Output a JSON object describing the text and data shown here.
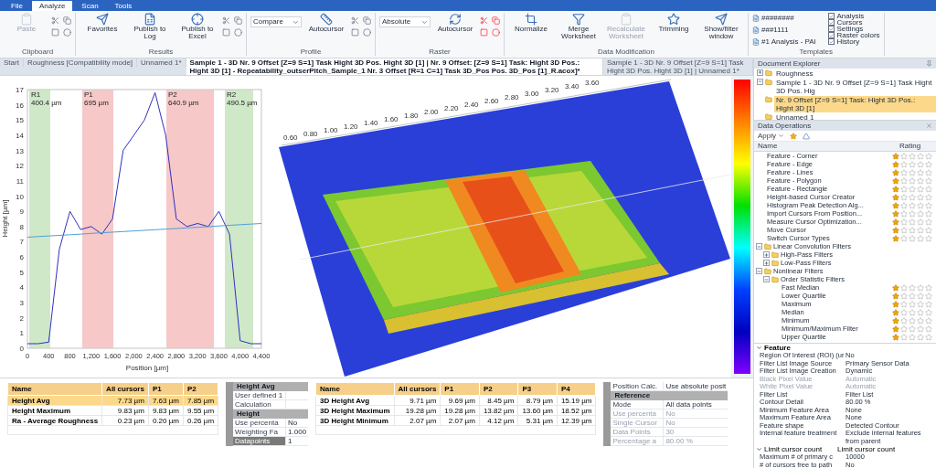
{
  "menu_tabs": [
    {
      "label": "File",
      "selected": false
    },
    {
      "label": "Analyze",
      "selected": true
    },
    {
      "label": "Scan",
      "selected": false
    },
    {
      "label": "Tools",
      "selected": false
    }
  ],
  "ribbon_groups": [
    {
      "caption": "Clipboard",
      "items": [
        {
          "kind": "large",
          "label": "Paste",
          "disabled": true
        }
      ]
    },
    {
      "caption": "Results",
      "items": [
        {
          "kind": "large",
          "label": "Favorites",
          "disabled": false
        },
        {
          "kind": "large",
          "label": "Publish to Log",
          "disabled": false
        },
        {
          "kind": "large",
          "label": "Publish to Excel",
          "disabled": false
        }
      ]
    },
    {
      "caption": "Profile",
      "items": [
        {
          "kind": "select",
          "value": "Compare"
        },
        {
          "kind": "large",
          "label": "Autocursor",
          "disabled": false
        }
      ]
    },
    {
      "caption": "Raster",
      "items": [
        {
          "kind": "select",
          "value": "Absolute"
        },
        {
          "kind": "large",
          "label": "Autocursor",
          "disabled": false
        }
      ]
    },
    {
      "caption": "Data Modification",
      "items": [
        {
          "kind": "large",
          "label": "Normalize",
          "disabled": false
        },
        {
          "kind": "large",
          "label": "Merge Worksheet",
          "disabled": false
        },
        {
          "kind": "large",
          "label": "Recalculate Worksheet",
          "disabled": true
        },
        {
          "kind": "large",
          "label": "Trimming",
          "disabled": false
        },
        {
          "kind": "large",
          "label": "Show/filter window",
          "disabled": false
        }
      ]
    },
    {
      "caption": "Templates",
      "items": [
        {
          "kind": "template",
          "label": "########"
        },
        {
          "kind": "template",
          "label": "###1111"
        },
        {
          "kind": "template",
          "label": "#1 Analysis - PAl"
        },
        {
          "kind": "check",
          "label": "Analysis",
          "checked": true
        },
        {
          "kind": "check",
          "label": "Cursors",
          "checked": true
        },
        {
          "kind": "check",
          "label": "Settings",
          "checked": true
        },
        {
          "kind": "check",
          "label": "Raster colors",
          "checked": true
        },
        {
          "kind": "check",
          "label": "History",
          "checked": true
        }
      ]
    }
  ],
  "document_tabs": [
    {
      "label": "Start",
      "selected": false
    },
    {
      "label": "Roughness [Compatibility mode]",
      "selected": false
    },
    {
      "label": "Unnamed 1*",
      "selected": false
    },
    {
      "label": "Sample 1 - 3D Nr. 9 Offset [Z=9 S=1] Task Hight 3D Pos. Hight 3D [1] | Nr. 9 Offset: [Z=9 S=1] Task: Hight 3D Pos.: Hight 3D [1] - Repeatability_outserPitch_Sample_1 Nr. 3 Offset [R=1 C=1] Task 3D_Pos Pos. 3D_Pos [1]_R.acox]*",
      "selected": true
    },
    {
      "label": "Sample 1 - 3D Nr. 9 Offset [Z=9 S=1] Task Hight 3D Pos. Hight 3D [1] | Unnamed 1*",
      "selected": false
    }
  ],
  "profile": {
    "chart_data": {
      "type": "line",
      "xlabel": "Position [µm]",
      "ylabel": "Height [µm]",
      "x": [
        0,
        200,
        400,
        600,
        800,
        1000,
        1200,
        1400,
        1600,
        1800,
        2000,
        2200,
        2400,
        2600,
        2800,
        3000,
        3200,
        3400,
        3600,
        3800,
        4000,
        4200,
        4400
      ],
      "series": [
        {
          "color": "#3030c0",
          "values": [
            0.3,
            0.3,
            0.4,
            6.5,
            9,
            7.8,
            8,
            7.5,
            8.5,
            13,
            14,
            15,
            16.8,
            14,
            8.5,
            8,
            8.2,
            8,
            9,
            7.5,
            0.5,
            0.3,
            0.3
          ]
        },
        {
          "color": "#4fa0d8",
          "values": [
            7.3,
            7.34,
            7.38,
            7.42,
            7.46,
            7.5,
            7.55,
            7.59,
            7.63,
            7.67,
            7.71,
            7.75,
            7.79,
            7.83,
            7.87,
            7.91,
            7.95,
            7.99,
            8.04,
            8.08,
            8.12,
            8.16,
            8.2
          ]
        }
      ],
      "xlim": [
        0,
        4400
      ],
      "ylim": [
        0,
        17
      ],
      "xticks": [
        0,
        400,
        800,
        {
          "value": 1200,
          "label": "1,200"
        },
        {
          "value": 1600,
          "label": "1,600"
        },
        {
          "value": 2000,
          "label": "2,000"
        },
        {
          "value": 2400,
          "label": "2,400"
        },
        {
          "value": 2800,
          "label": "2,800"
        },
        {
          "value": 3200,
          "label": "3,200"
        },
        {
          "value": 3600,
          "label": "3,600"
        },
        {
          "value": 4000,
          "label": "4,000"
        },
        {
          "value": 4400,
          "label": "4,400"
        }
      ],
      "yticks": [
        0,
        1,
        2,
        3,
        4,
        5,
        6,
        7,
        8,
        9,
        10,
        11,
        12,
        13,
        14,
        15,
        16,
        17
      ]
    },
    "cursors": [
      {
        "label": "R1",
        "reading": "400.4 µm",
        "color": "#cfe8c8"
      },
      {
        "label": "P1",
        "reading": "695 µm",
        "color": "#f6c8c8"
      },
      {
        "label": "P2",
        "reading": "640.9 µm",
        "color": "#f6c8c8"
      },
      {
        "label": "R2",
        "reading": "490.5 µm",
        "color": "#cfe8c8"
      }
    ]
  },
  "surface_view": {
    "axis_labels": [
      "0.60",
      "0.80",
      "1.00",
      "1.20",
      "1.40",
      "1.60",
      "1.80",
      "2.00",
      "2.20",
      "2.40",
      "2.60",
      "2.80",
      "3.00",
      "3.20",
      "3.40",
      "3.60"
    ]
  },
  "results_table": {
    "columns": [
      "Name",
      "All cursors",
      "P1",
      "P2"
    ],
    "rows": [
      {
        "cells": [
          "Height Avg",
          "7.73 µm",
          "7.63 µm",
          "7.85 µm"
        ],
        "selected": true
      },
      {
        "cells": [
          "Height Maximum",
          "9.83 µm",
          "9.83 µm",
          "9.55 µm"
        ],
        "selected": false
      },
      {
        "cells": [
          "Ra - Average Roughness",
          "0.23 µm",
          "0.20 µm",
          "0.26 µm"
        ],
        "selected": false
      }
    ]
  },
  "parameter_grid": {
    "rows": [
      {
        "kind": "category",
        "label": "Height Avg"
      },
      {
        "kind": "property",
        "label": "User defined 1",
        "disabled": false,
        "selected": false
      },
      {
        "kind": "property",
        "label": "Calculation",
        "disabled": false,
        "selected": false
      },
      {
        "kind": "category",
        "label": "Height"
      },
      {
        "kind": "property",
        "label": "Use percenta",
        "value": "No",
        "disabled": false,
        "selected": false
      },
      {
        "kind": "property",
        "label": "Weighting Fa",
        "value": "1.000",
        "disabled": false,
        "selected": false
      },
      {
        "kind": "property",
        "label": "Datapoints",
        "value": "1",
        "disabled": false,
        "selected": true
      }
    ]
  },
  "surface_table": {
    "columns": [
      "Name",
      "All cursors",
      "P1",
      "P2",
      "P3",
      "P4"
    ],
    "rows": [
      {
        "cells": [
          "3D Height Avg",
          "9.71 µm",
          "9.69 µm",
          "8.45 µm",
          "8.79 µm",
          "15.19 µm"
        ],
        "selected": false
      },
      {
        "cells": [
          "3D Height Maximum",
          "19.28 µm",
          "19.28 µm",
          "13.82 µm",
          "13.60 µm",
          "18.52 µm"
        ],
        "selected": false
      },
      {
        "cells": [
          "3D Height Minimum",
          "2.07 µm",
          "2.07 µm",
          "4.12 µm",
          "5.31 µm",
          "12.39 µm"
        ],
        "selected": false
      }
    ]
  },
  "surface_grid": {
    "rows": [
      {
        "kind": "property",
        "label": "Position Calc.",
        "value": "Use absolute posit",
        "disabled": false,
        "selected": false
      },
      {
        "kind": "category",
        "label": "Reference"
      },
      {
        "kind": "property",
        "label": "Mode",
        "value": "All data points",
        "disabled": false,
        "selected": false
      },
      {
        "kind": "property",
        "label": "Use percenta",
        "value": "No",
        "disabled": true,
        "selected": false
      },
      {
        "kind": "property",
        "label": "Single Cursor",
        "value": "No",
        "disabled": true,
        "selected": false
      },
      {
        "kind": "property",
        "label": "Data Points",
        "value": "30",
        "disabled": true,
        "selected": false
      },
      {
        "kind": "property",
        "label": "Percentage a",
        "value": "80.00 %",
        "disabled": true,
        "selected": false
      }
    ]
  },
  "document_explorer": {
    "title": "Document Explorer",
    "tree": [
      {
        "label": "Roughness",
        "expanded": false,
        "selected": false
      },
      {
        "label": "Sample 1 - 3D Nr. 9 Offset [Z=9 S=1] Task Hight 3D Pos. Hig",
        "expanded": true,
        "selected": false,
        "children": [
          {
            "label": "Nr. 9 Offset [Z=9 S=1] Task: Hight 3D Pos.: Hight 3D [1]",
            "selected": true
          },
          {
            "label": "Unnamed 1",
            "selected": false
          }
        ]
      }
    ]
  },
  "data_operations": {
    "title": "Data Operations",
    "apply": "Apply",
    "columns": [
      "Name",
      "Rating"
    ],
    "items": [
      {
        "kind": "operation",
        "label": "Feature - Corner",
        "stars": 1
      },
      {
        "kind": "operation",
        "label": "Feature - Edge",
        "stars": 1
      },
      {
        "kind": "operation",
        "label": "Feature - Lines",
        "stars": 1
      },
      {
        "kind": "operation",
        "label": "Feature - Polygon",
        "stars": 1
      },
      {
        "kind": "operation",
        "label": "Feature - Rectangle",
        "stars": 1
      },
      {
        "kind": "operation",
        "label": "Height-based Cursor Creator",
        "stars": 1
      },
      {
        "kind": "operation",
        "label": "Histogram Peak Detection Alg...",
        "stars": 1
      },
      {
        "kind": "operation",
        "label": "Import Cursors From Position...",
        "stars": 1
      },
      {
        "kind": "operation",
        "label": "Measure Cursor Optimization...",
        "stars": 1
      },
      {
        "kind": "operation",
        "label": "Move Cursor",
        "stars": 1
      },
      {
        "kind": "operation",
        "label": "Switch Cursor Types",
        "stars": 1
      },
      {
        "kind": "folder",
        "label": "Linear Convolution Filters",
        "expanded": true,
        "children": [
          {
            "kind": "folder",
            "label": "High-Pass Filters",
            "expanded": false
          },
          {
            "kind": "folder",
            "label": "Low-Pass Filters",
            "expanded": false
          }
        ]
      },
      {
        "kind": "folder",
        "label": "Nonlinear Filters",
        "expanded": true,
        "children": [
          {
            "kind": "folder",
            "label": "Order Statistic Filters",
            "expanded": true,
            "children": [
              {
                "kind": "operation",
                "label": "Fast Median",
                "stars": 1
              },
              {
                "kind": "operation",
                "label": "Lower Quartile",
                "stars": 1
              },
              {
                "kind": "operation",
                "label": "Maximum",
                "stars": 1
              },
              {
                "kind": "operation",
                "label": "Median",
                "stars": 1
              },
              {
                "kind": "operation",
                "label": "Minimum",
                "stars": 1
              },
              {
                "kind": "operation",
                "label": "Minimum/Maximum Filter",
                "stars": 1
              },
              {
                "kind": "operation",
                "label": "Upper Quartile",
                "stars": 1
              }
            ]
          }
        ]
      }
    ]
  },
  "properties": {
    "groups": [
      {
        "label": "Feature",
        "expanded": true,
        "rows": [
          {
            "label": "Region Of Interest (ROI) (ur",
            "value": "No",
            "disabled": false
          },
          {
            "label": "Filter List Image Source",
            "value": "Primary Sensor Data",
            "disabled": false
          },
          {
            "label": "Filter List Image Creation",
            "value": "Dynamic",
            "disabled": false
          },
          {
            "label": "Black Pixel Value",
            "value": "Automatic",
            "disabled": true
          },
          {
            "label": "White Pixel Value",
            "value": "Automatic",
            "disabled": true
          },
          {
            "label": "Filter List",
            "value": "Filter List",
            "disabled": false
          },
          {
            "label": "Contour Detail",
            "value": "80.00 %",
            "disabled": false
          },
          {
            "label": "Minimum Feature Area",
            "value": "None",
            "disabled": false
          },
          {
            "label": "Maximum Feature Area",
            "value": "None",
            "disabled": false
          },
          {
            "label": "Feature shape",
            "value": "Detected Contour",
            "disabled": false
          },
          {
            "label": "Internal feature treatment",
            "value": "Exclude internal features from parent",
            "disabled": false
          }
        ]
      },
      {
        "label": "Limit cursor count",
        "value": "Limit cursor count",
        "expanded": true,
        "rows": [
          {
            "label": "Maximum # of primary c",
            "value": "10000",
            "disabled": false
          },
          {
            "label": "# of cursors free to path",
            "value": "No",
            "disabled": false
          }
        ]
      }
    ]
  }
}
